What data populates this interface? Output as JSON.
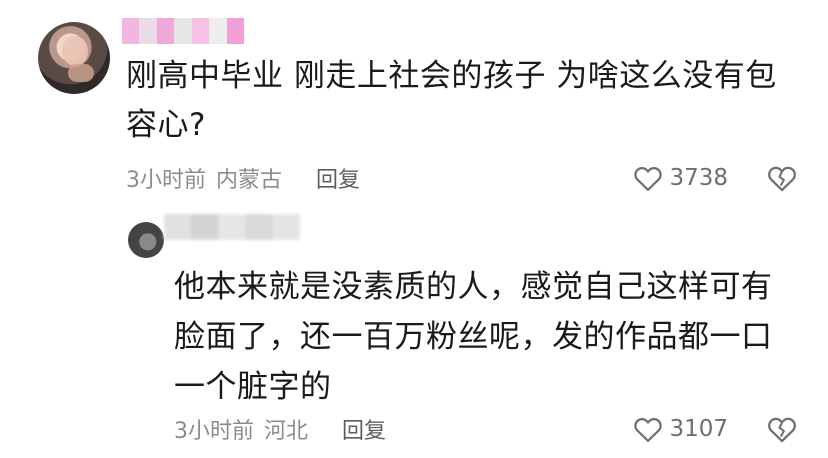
{
  "comment": {
    "text": "刚高中毕业 刚走上社会的孩子 为啥这么没有包容心?",
    "time": "3小时前",
    "location": "内蒙古",
    "reply_label": "回复",
    "likes": "3738"
  },
  "reply": {
    "text": "他本来就是没素质的人，感觉自己这样可有脸面了，还一百万粉丝呢，发的作品都一口一个脏字的",
    "time": "3小时前",
    "location": "河北",
    "reply_label": "回复",
    "likes": "3107"
  },
  "icons": {
    "like": "heart-outline-icon",
    "dislike": "broken-heart-icon"
  },
  "colors": {
    "name_blur_pink": "#f4a8dc",
    "meta_gray": "#8c8c8c",
    "text": "#1a1a1a"
  }
}
